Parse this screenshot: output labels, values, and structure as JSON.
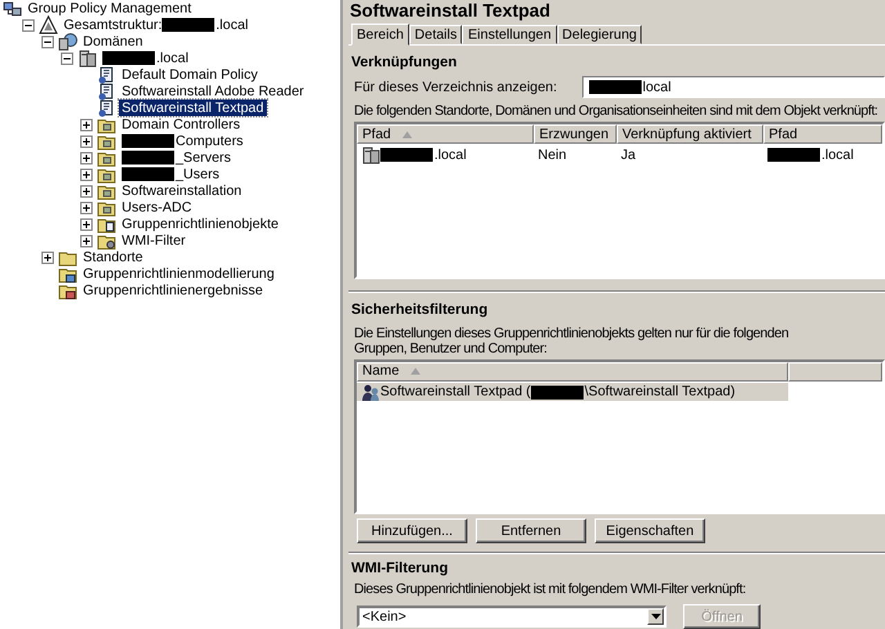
{
  "tree": {
    "label": "Group Policy Management",
    "kind": "console",
    "selected": false,
    "children": [
      {
        "parts": [
          {
            "kind": "text",
            "text": "Gesamtstruktur:"
          },
          {
            "kind": "redacted"
          },
          {
            "kind": "text",
            "text": ".local"
          }
        ],
        "kind": "forest",
        "selected": false,
        "expanded": true,
        "children": [
          {
            "label": "Domänen",
            "kind": "domains",
            "selected": false,
            "expanded": true,
            "children": [
              {
                "parts": [
                  {
                    "kind": "redacted"
                  },
                  {
                    "kind": "text",
                    "text": ".local"
                  }
                ],
                "kind": "domain",
                "selected": false,
                "expanded": true,
                "children": [
                  {
                    "label": "Default Domain Policy",
                    "kind": "gpo",
                    "selected": false
                  },
                  {
                    "label": "Softwareinstall Adobe Reader",
                    "kind": "gpo",
                    "selected": false
                  },
                  {
                    "label": "Softwareinstall Textpad",
                    "kind": "gpo",
                    "selected": true
                  },
                  {
                    "label": "Domain Controllers",
                    "kind": "ou",
                    "selected": false,
                    "expanded": false
                  },
                  {
                    "parts": [
                      {
                        "kind": "redacted"
                      },
                      {
                        "kind": "text",
                        "text": "Computers"
                      }
                    ],
                    "kind": "ou",
                    "selected": false,
                    "expanded": false
                  },
                  {
                    "parts": [
                      {
                        "kind": "redacted"
                      },
                      {
                        "kind": "text",
                        "text": "_Servers"
                      }
                    ],
                    "kind": "ou",
                    "selected": false,
                    "expanded": false
                  },
                  {
                    "parts": [
                      {
                        "kind": "redacted"
                      },
                      {
                        "kind": "text",
                        "text": "_Users"
                      }
                    ],
                    "kind": "ou",
                    "selected": false,
                    "expanded": false
                  },
                  {
                    "label": "Softwareinstallation",
                    "kind": "ou",
                    "selected": false,
                    "expanded": false
                  },
                  {
                    "label": "Users-ADC",
                    "kind": "ou",
                    "selected": false,
                    "expanded": false
                  },
                  {
                    "label": "Gruppenrichtlinienobjekte",
                    "kind": "gpo-folder",
                    "selected": false,
                    "expanded": false
                  },
                  {
                    "label": "WMI-Filter",
                    "kind": "wmi-folder",
                    "selected": false,
                    "expanded": false
                  }
                ]
              }
            ]
          },
          {
            "label": "Standorte",
            "kind": "folder",
            "selected": false,
            "expanded": false
          },
          {
            "label": "Gruppenrichtlinienmodellierung",
            "kind": "modeling",
            "selected": false
          },
          {
            "label": "Gruppenrichtlinienergebnisse",
            "kind": "results",
            "selected": false
          }
        ]
      }
    ]
  },
  "details": {
    "title": "Softwareinstall Textpad",
    "tabs": [
      {
        "label": "Bereich",
        "selected": true
      },
      {
        "label": "Details",
        "selected": false
      },
      {
        "label": "Einstellungen",
        "selected": false
      },
      {
        "label": "Delegierung",
        "selected": false
      }
    ],
    "links": {
      "heading": "Verknüpfungen",
      "location_label": "Für dieses Verzeichnis anzeigen:",
      "location_value": [
        {
          "kind": "redacted"
        },
        {
          "kind": "text",
          "text": "local"
        }
      ],
      "description": "Die folgenden Standorte, Domänen und Organisationseinheiten sind mit dem Objekt verknüpft:",
      "columns": [
        {
          "label": "Pfad",
          "sorted": true
        },
        {
          "label": "Erzwungen"
        },
        {
          "label": "Verknüpfung aktiviert"
        },
        {
          "label": "Pfad"
        }
      ],
      "rows": [
        {
          "kind": "domain",
          "selected": false,
          "cells": [
            [
              {
                "kind": "redacted"
              },
              {
                "kind": "text",
                "text": ".local"
              }
            ],
            [
              {
                "kind": "text",
                "text": "Nein"
              }
            ],
            [
              {
                "kind": "text",
                "text": "Ja"
              }
            ],
            [
              {
                "kind": "redacted"
              },
              {
                "kind": "text",
                "text": ".local"
              }
            ]
          ]
        }
      ]
    },
    "security": {
      "heading": "Sicherheitsfilterung",
      "description": "Die Einstellungen dieses Gruppenrichtlinienobjekts gelten nur für die folgenden\nGruppen, Benutzer und Computer:",
      "columns": [
        {
          "label": "Name",
          "sorted": true
        }
      ],
      "rows": [
        {
          "kind": "group",
          "selected": true,
          "parts": [
            {
              "kind": "text",
              "text": "Softwareinstall Textpad ("
            },
            {
              "kind": "redacted"
            },
            {
              "kind": "text",
              "text": "\\Softwareinstall Textpad)"
            }
          ]
        }
      ],
      "buttons": [
        {
          "label": "Hinzufügen...",
          "disabled": false
        },
        {
          "label": "Entfernen",
          "disabled": false
        },
        {
          "label": "Eigenschaften",
          "disabled": false
        }
      ]
    },
    "wmi": {
      "heading": "WMI-Filterung",
      "description": "Dieses Gruppenrichtlinienobjekt ist mit folgendem WMI-Filter verknüpft:",
      "combo_value": "<Kein>",
      "open_button": {
        "label": "Öffnen",
        "disabled": true
      }
    }
  }
}
